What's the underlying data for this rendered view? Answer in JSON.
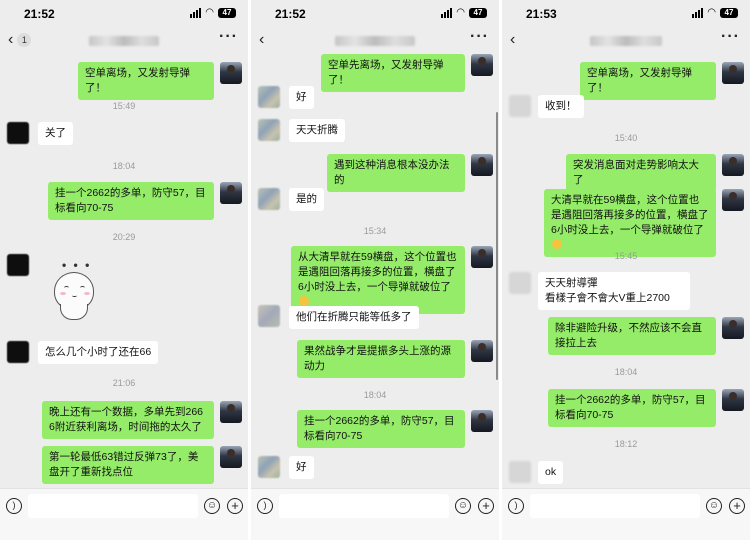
{
  "panels": [
    {
      "status_time": "21:52",
      "battery": "47",
      "unread_count": "1",
      "messages": {
        "m1": "空单离场，又发射导弹了！",
        "ts1": "15:49",
        "m2": "关了",
        "ts2": "18:04",
        "m3": "挂一个2662的多单，防守57，目标看向70-75",
        "ts3": "20:29",
        "sticker_dots": "• • •",
        "m4": "怎么几个小时了还在66",
        "ts4": "21:06",
        "m5": "晚上还有一个数据，多单先到2666附近获利离场，时间拖的太久了",
        "m6": "第一轮最低63错过反弹73了，美盘开了重新找点位"
      }
    },
    {
      "status_time": "21:52",
      "battery": "47",
      "messages": {
        "m1": "空单先离场，又发射导弹了！",
        "m2": "好",
        "m3": "天天折腾",
        "m4": "遇到这种消息根本没办法的",
        "m5": "是的",
        "ts1": "15:34",
        "m6": "从大清早就在59横盘，这个位置也是遇阻回落再接多的位置，横盘了6小时没上去，一个导弹就破位了",
        "m7": "他们在折腾只能等低多了",
        "m8": "果然战争才是提振多头上涨的源动力",
        "ts2": "18:04",
        "m9": "挂一个2662的多单，防守57，目标看向70-75",
        "m10": "好"
      }
    },
    {
      "status_time": "21:53",
      "battery": "47",
      "messages": {
        "m1": "空单离场，又发射导弹了！",
        "m2": "收到！",
        "ts1": "15:40",
        "m3": "突发消息面对走势影响太大了",
        "m4": "大清早就在59横盘，这个位置也是遇阻回落再接多的位置，横盘了6小时没上去，一个导弹就破位了",
        "ts2": "15:45",
        "m5a": "天天射導彈",
        "m5b": "看樣子會不會大V重上2700",
        "m6": "除非避险升级，不然应该不会直接拉上去",
        "ts3": "18:04",
        "m7": "挂一个2662的多单，防守57，目标看向70-75",
        "ts4": "18:12",
        "m8": "ok"
      }
    }
  ],
  "icons": {
    "voice": "voice-icon",
    "emoji": "emoji-icon",
    "plus": "plus-icon",
    "back": "back-chevron-icon",
    "more": "more-icon"
  },
  "colors": {
    "sent_bubble": "#95ec69",
    "received_bubble": "#ffffff",
    "chat_background": "#ededed",
    "timestamp": "#9a9a9a"
  }
}
